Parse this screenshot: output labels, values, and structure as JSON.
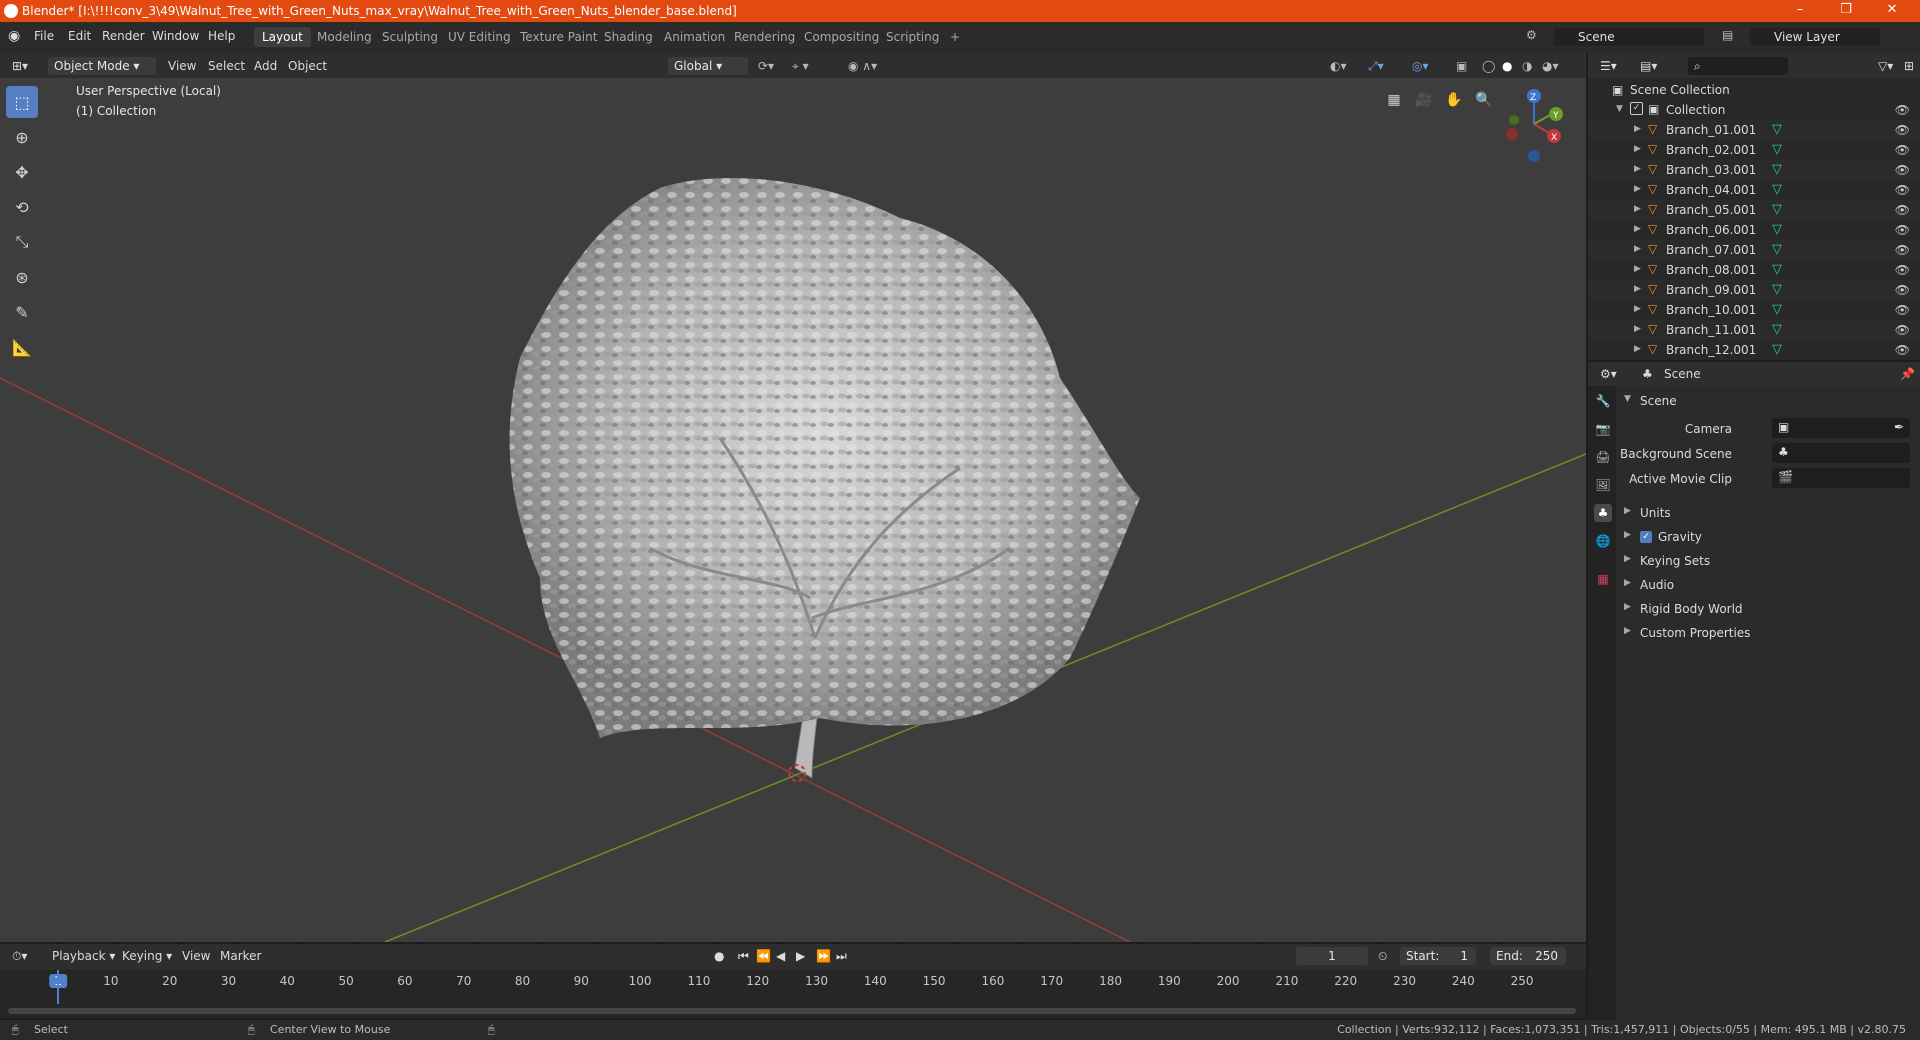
{
  "window": {
    "title": "Blender* [I:\\!!!!conv_3\\49\\Walnut_Tree_with_Green_Nuts_max_vray\\Walnut_Tree_with_Green_Nuts_blender_base.blend]",
    "minimize": "–",
    "maximize": "❐",
    "close": "✕"
  },
  "menu": {
    "items": [
      "File",
      "Edit",
      "Render",
      "Window",
      "Help"
    ],
    "workspaces": [
      "Layout",
      "Modeling",
      "Sculpting",
      "UV Editing",
      "Texture Paint",
      "Shading",
      "Animation",
      "Rendering",
      "Compositing",
      "Scripting"
    ],
    "active_workspace": "Layout",
    "add_workspace": "+",
    "scene": "Scene",
    "view_layer": "View Layer"
  },
  "viewport_header": {
    "mode": "Object Mode",
    "view": "View",
    "select": "Select",
    "add": "Add",
    "object": "Object",
    "orientation": "Global"
  },
  "viewport": {
    "perspective": "User Perspective (Local)",
    "collection": "(1) Collection",
    "gizmo": {
      "z": "Z",
      "y": "Y",
      "x": "X"
    },
    "colors": {
      "background": "#3d3d3d",
      "x_axis": "#c0393b",
      "y_axis": "#6e9b2a",
      "z_axis": "#3c76c9"
    }
  },
  "tools": [
    "select-box",
    "cursor",
    "move",
    "rotate",
    "scale",
    "transform",
    "annotate",
    "measure"
  ],
  "outliner": {
    "root": "Scene Collection",
    "collection": "Collection",
    "items": [
      "Branch_01.001",
      "Branch_02.001",
      "Branch_03.001",
      "Branch_04.001",
      "Branch_05.001",
      "Branch_06.001",
      "Branch_07.001",
      "Branch_08.001",
      "Branch_09.001",
      "Branch_10.001",
      "Branch_11.001",
      "Branch_12.001"
    ]
  },
  "properties": {
    "context": "Scene",
    "panel_title": "Scene",
    "camera_label": "Camera",
    "bg_scene_label": "Background Scene",
    "movie_clip_label": "Active Movie Clip",
    "sections": [
      "Units",
      "Gravity",
      "Keying Sets",
      "Audio",
      "Rigid Body World",
      "Custom Properties"
    ],
    "gravity_checked": true
  },
  "timeline": {
    "playback": "Playback",
    "keying": "Keying",
    "view": "View",
    "marker": "Marker",
    "current_frame": "1",
    "start_label": "Start:",
    "start": "1",
    "end_label": "End:",
    "end": "250",
    "ticks": [
      "1",
      "10",
      "20",
      "30",
      "40",
      "50",
      "60",
      "70",
      "80",
      "90",
      "100",
      "110",
      "120",
      "130",
      "140",
      "150",
      "160",
      "170",
      "180",
      "190",
      "200",
      "210",
      "220",
      "230",
      "240",
      "250"
    ]
  },
  "status": {
    "left_action": "Select",
    "middle_action": "Center View to Mouse",
    "stats": "Collection | Verts:932,112 | Faces:1,073,351 | Tris:1,457,911 | Objects:0/55 | Mem: 495.1 MB | v2.80.75"
  }
}
